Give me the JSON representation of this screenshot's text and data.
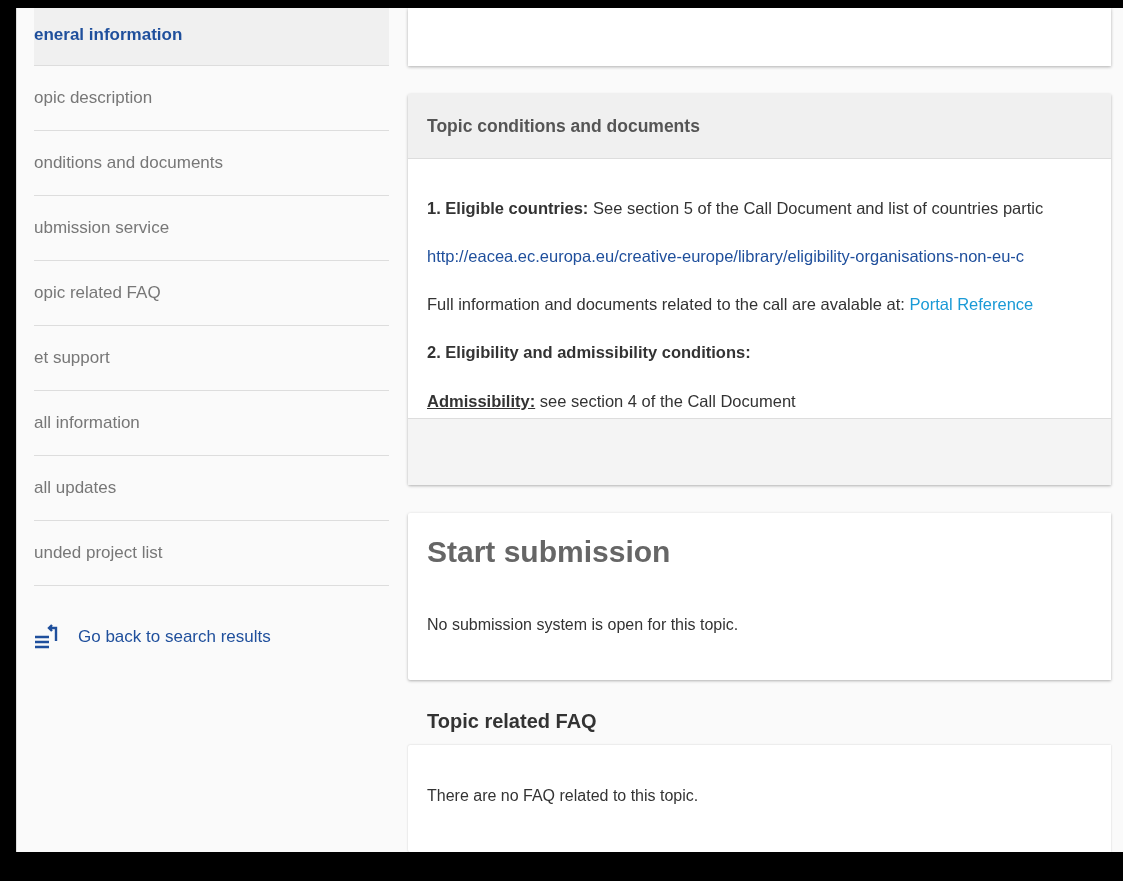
{
  "sidebar": {
    "items": [
      {
        "label": "eneral information",
        "selected": true
      },
      {
        "label": "opic description",
        "selected": false
      },
      {
        "label": "onditions and documents",
        "selected": false
      },
      {
        "label": "ubmission service",
        "selected": false
      },
      {
        "label": "opic related FAQ",
        "selected": false
      },
      {
        "label": "et support",
        "selected": false
      },
      {
        "label": "all information",
        "selected": false
      },
      {
        "label": "all updates",
        "selected": false
      },
      {
        "label": "unded project list",
        "selected": false
      }
    ],
    "back_link": "Go back to search results"
  },
  "conditions_card": {
    "title": "Topic conditions and documents",
    "paragraphs": [
      {
        "kind": "text",
        "text": "**1. Eligible countries:** See section 5 of the Call Document  and list of countries partic"
      },
      {
        "kind": "link",
        "text": "http://eacea.ec.europa.eu/creative-europe/library/eligibility-organisations-non-eu-c"
      },
      {
        "kind": "text-link",
        "text": "Full information and documents related to the call are avalable at:",
        "link": "Portal Reference"
      },
      {
        "kind": "text",
        "text": "**2. Eligibility and admissibility conditions:**"
      },
      {
        "kind": "underlined",
        "text": "**Admissibility:** see section 4 of the Call Document"
      }
    ]
  },
  "submission_card": {
    "title": "Start submission",
    "text": "No submission system is open for this topic."
  },
  "faq": {
    "title": "Topic related FAQ",
    "text": "There are no FAQ related to this topic."
  }
}
